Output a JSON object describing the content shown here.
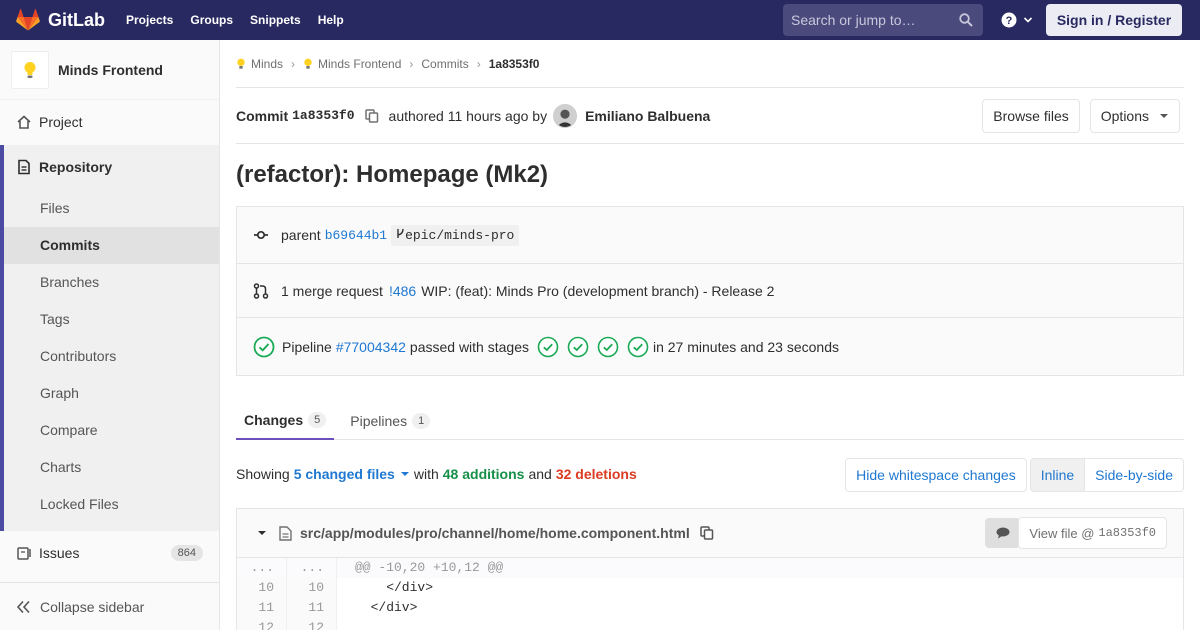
{
  "navbar": {
    "brand": "GitLab",
    "links": [
      "Projects",
      "Groups",
      "Snippets",
      "Help"
    ],
    "search_placeholder": "Search or jump to…",
    "sign_in": "Sign in / Register",
    "bg_color": "#292961"
  },
  "sidebar": {
    "project_name": "Minds Frontend",
    "project": "Project",
    "repository": "Repository",
    "repo_items": [
      "Files",
      "Commits",
      "Branches",
      "Tags",
      "Contributors",
      "Graph",
      "Compare",
      "Charts",
      "Locked Files"
    ],
    "active_item": "Commits",
    "issues": "Issues",
    "issues_count": "864",
    "collapse": "Collapse sidebar"
  },
  "breadcrumb": {
    "items": [
      "Minds",
      "Minds Frontend",
      "Commits",
      "1a8353f0"
    ]
  },
  "commit": {
    "label": "Commit",
    "sha": "1a8353f0",
    "authored": "authored 11 hours ago by",
    "author": "Emiliano Balbuena",
    "browse_files": "Browse files",
    "options": "Options",
    "title": "(refactor): Homepage (Mk2)",
    "parent_label": "parent",
    "parent_sha": "b69644b1",
    "branch": "epic/minds-pro",
    "mr_text": "1 merge request",
    "mr_id": "!486",
    "mr_title": "WIP: (feat): Minds Pro (development branch) - Release 2",
    "pipeline_label": "Pipeline",
    "pipeline_id": "#77004342",
    "pipeline_status": "passed with stages",
    "pipeline_duration": "in 27 minutes and 23 seconds",
    "stages": 4
  },
  "tabs": [
    {
      "label": "Changes",
      "count": "5"
    },
    {
      "label": "Pipelines",
      "count": "1"
    }
  ],
  "changes": {
    "showing": "Showing",
    "files": "5 changed files",
    "with": "with",
    "additions": "48 additions",
    "and": "and",
    "deletions": "32 deletions",
    "hide_ws": "Hide whitespace changes",
    "inline": "Inline",
    "side_by_side": "Side-by-side"
  },
  "file": {
    "path": "src/app/modules/pro/channel/home/home.component.html",
    "view_file": "View file @",
    "view_sha": "1a8353f0",
    "lines": [
      {
        "old": "...",
        "new": "...",
        "code": "@@ -10,20 +10,12 @@"
      },
      {
        "old": "10",
        "new": "10",
        "code": "    </div>"
      },
      {
        "old": "11",
        "new": "11",
        "code": "  </div>"
      },
      {
        "old": "12",
        "new": "12",
        "code": ""
      }
    ]
  },
  "colors": {
    "addition": "#168f48",
    "deletion": "#db3b21",
    "success": "#1aaa55",
    "link": "#1f78d1",
    "active_tab": "#6b4fbb"
  }
}
